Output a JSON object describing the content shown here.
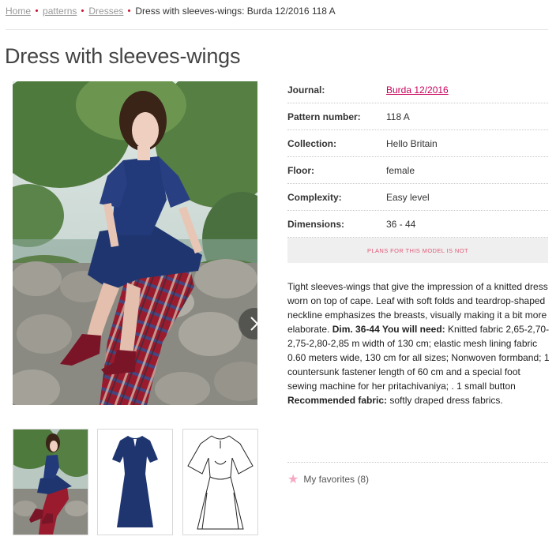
{
  "breadcrumb": {
    "home": "Home",
    "patterns": "patterns",
    "dresses": "Dresses",
    "current": "Dress with sleeves-wings: Burda 12/2016 118 A"
  },
  "page": {
    "title": "Dress with sleeves-wings"
  },
  "specs": [
    {
      "label": "Journal:",
      "value": "Burda 12/2016"
    },
    {
      "label": "Pattern number:",
      "value": "118 A"
    },
    {
      "label": "Collection:",
      "value": "Hello Britain"
    },
    {
      "label": "Floor:",
      "value": "female"
    },
    {
      "label": "Complexity:",
      "value": "Easy level"
    },
    {
      "label": "Dimensions:",
      "value": "36 - 44"
    }
  ],
  "plans": {
    "label": "PLANS FOR THIS MODEL IS NOT"
  },
  "description": {
    "text1": "Tight sleeves-wings that give the impression of a knitted dress worn on top of cape. Leaf with soft folds and teardrop-shaped neckline emphasizes the breasts, visually making it a bit more elaborate. ",
    "bold1": "Dim. 36-44 You will need:",
    "text2": " Knitted fabric 2,65-2,70-2,75-2,80-2,85 m width of 130 cm; elastic mesh lining fabric 0.60 meters wide, 130 cm for all sizes; Nonwoven formband; 1 countersunk fastener length of 60 cm and a special foot sewing machine for her pritachivaniya; . 1 small button ",
    "bold2": "Recommended fabric:",
    "text3": " softly draped dress fabrics."
  },
  "favorites": {
    "label": "My favorites (8)",
    "icon": "star-icon"
  },
  "colors": {
    "accent": "#c8005a",
    "breadcrumb_dot": "#c8102e",
    "dress": "#1f3570"
  }
}
